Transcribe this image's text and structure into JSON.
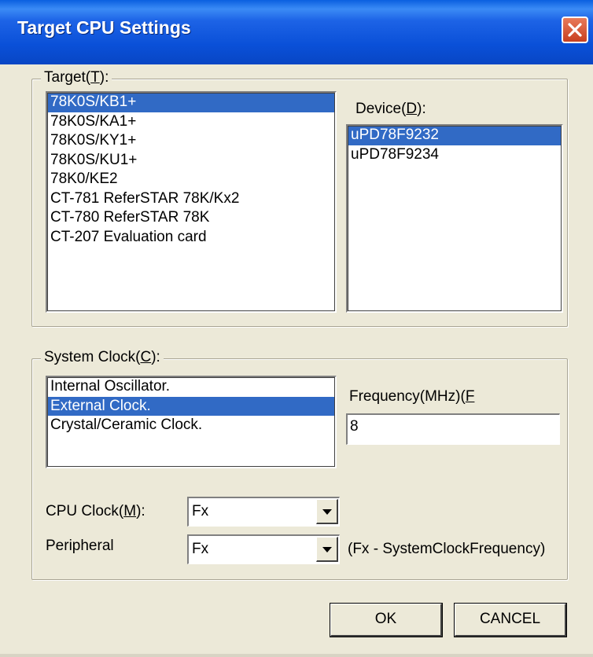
{
  "window": {
    "title": "Target CPU Settings"
  },
  "target": {
    "group_label_pre": "Target(",
    "group_label_key": "T",
    "group_label_post": "):",
    "items": [
      "78K0S/KB1+",
      "78K0S/KA1+",
      "78K0S/KY1+",
      "78K0S/KU1+",
      "78K0/KE2",
      "CT-781  ReferSTAR 78K/Kx2",
      "CT-780  ReferSTAR 78K",
      "CT-207  Evaluation card"
    ],
    "selected_index": 0
  },
  "device": {
    "label_pre": "Device(",
    "label_key": "D",
    "label_post": "):",
    "items": [
      "uPD78F9232",
      "uPD78F9234"
    ],
    "selected_index": 0
  },
  "system_clock": {
    "group_label_pre": "System Clock(",
    "group_label_key": "C",
    "group_label_post": "):",
    "items": [
      "Internal Oscillator.",
      "External Clock.",
      "Crystal/Ceramic Clock."
    ],
    "selected_index": 1
  },
  "frequency": {
    "label_pre": "Frequency(MHz)(",
    "label_key": "F",
    "value": "8"
  },
  "cpu_clock": {
    "label_pre": "CPU Clock(",
    "label_key": "M",
    "label_post": "):",
    "value": "Fx"
  },
  "peripheral": {
    "label": "Peripheral",
    "value": "Fx",
    "note": "(Fx - SystemClockFrequency)"
  },
  "buttons": {
    "ok": "OK",
    "cancel": "CANCEL"
  }
}
